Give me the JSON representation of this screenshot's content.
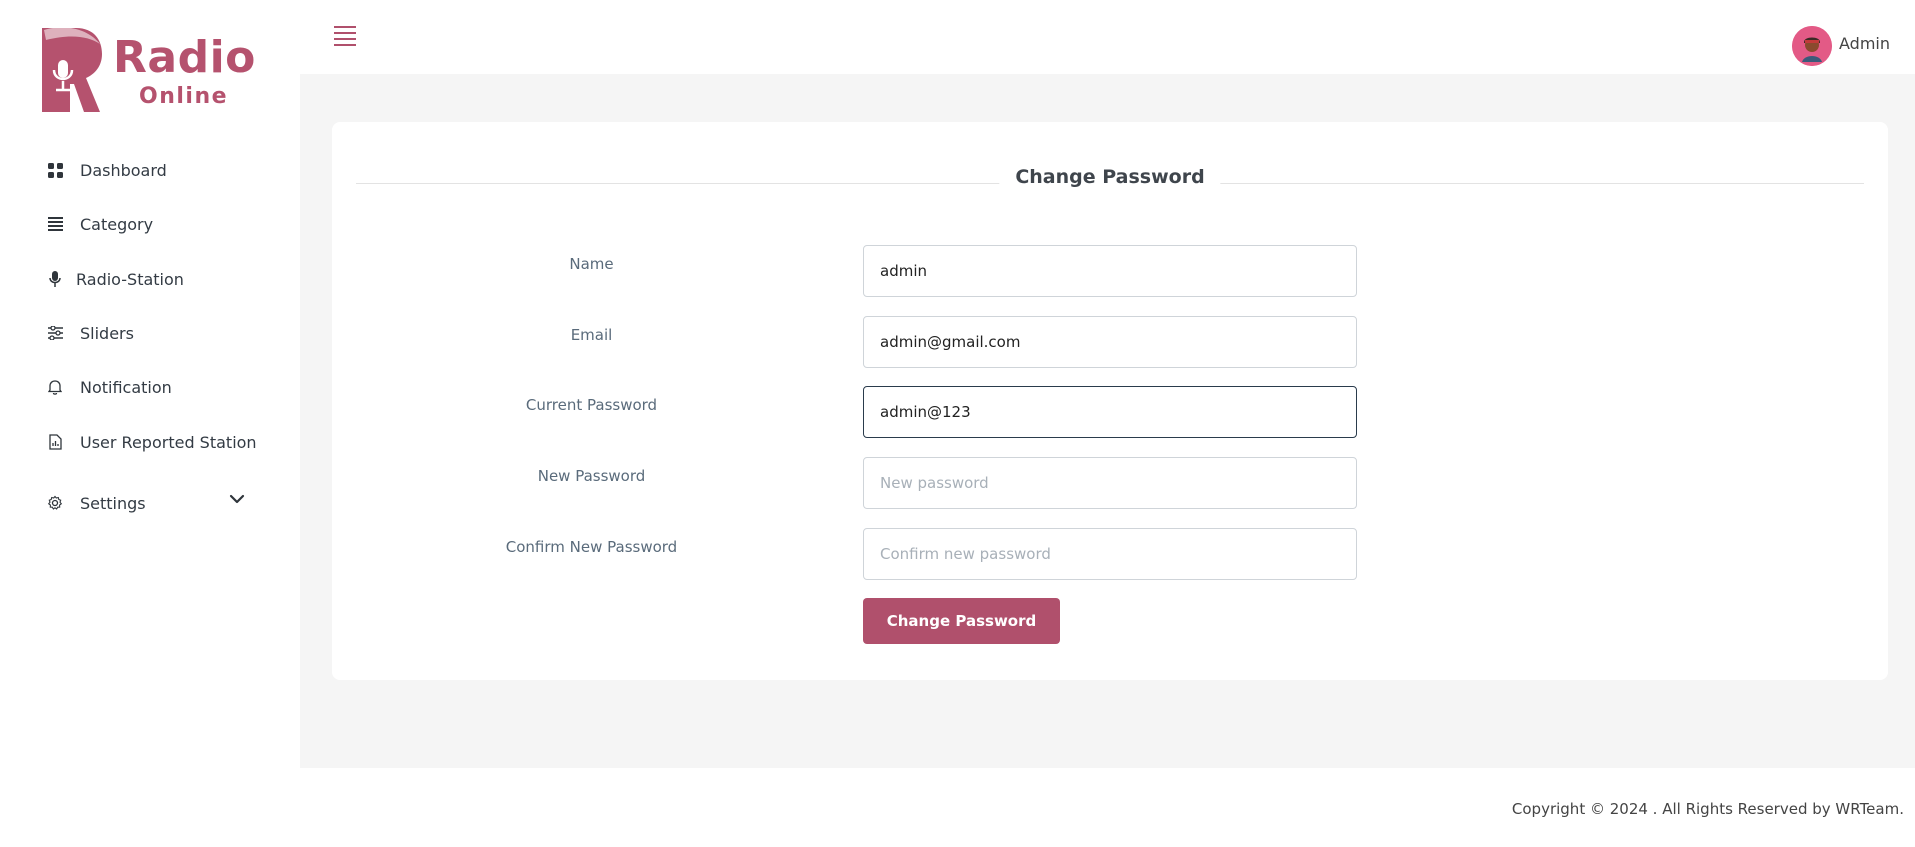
{
  "brand": {
    "title": "Radio",
    "subtitle": "Online",
    "color": "#b5526e"
  },
  "sidebar": {
    "items": [
      {
        "label": "Dashboard",
        "icon": "grid-icon"
      },
      {
        "label": "Category",
        "icon": "list-icon"
      },
      {
        "label": "Radio-Station",
        "icon": "microphone-icon"
      },
      {
        "label": "Sliders",
        "icon": "sliders-icon"
      },
      {
        "label": "Notification",
        "icon": "bell-icon"
      },
      {
        "label": "User Reported Station",
        "icon": "report-icon"
      },
      {
        "label": "Settings",
        "icon": "gear-icon"
      }
    ]
  },
  "header": {
    "user_name": "Admin"
  },
  "form": {
    "title": "Change Password",
    "fields": [
      {
        "label": "Name",
        "value": "admin",
        "placeholder": ""
      },
      {
        "label": "Email",
        "value": "admin@gmail.com",
        "placeholder": ""
      },
      {
        "label": "Current Password",
        "value": "admin@123",
        "placeholder": ""
      },
      {
        "label": "New Password",
        "value": "",
        "placeholder": "New password"
      },
      {
        "label": "Confirm New Password",
        "value": "",
        "placeholder": "Confirm new password"
      }
    ],
    "submit_label": "Change Password"
  },
  "footer": {
    "copyright": "Copyright © 2024 . All Rights Reserved by WRTeam."
  },
  "colors": {
    "accent": "#b0506c",
    "background": "#f5f5f5"
  }
}
